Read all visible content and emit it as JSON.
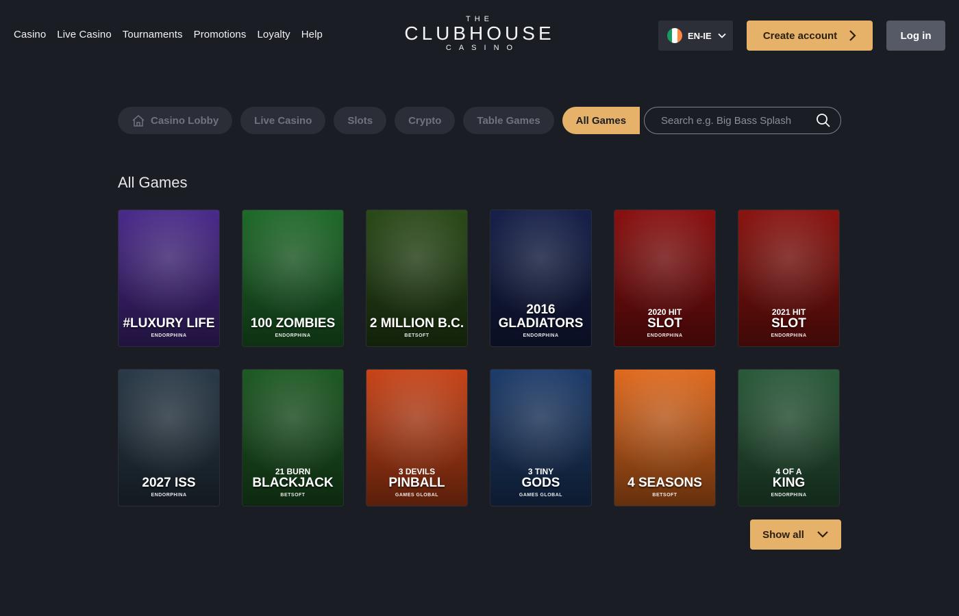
{
  "nav": {
    "links": [
      "Casino",
      "Live Casino",
      "Tournaments",
      "Promotions",
      "Loyalty",
      "Help"
    ]
  },
  "logo": {
    "top": "THE",
    "name": "CLUBHOUSE",
    "bottom": "CASINO"
  },
  "language": {
    "label": "EN-IE",
    "flag": "ireland-flag-icon"
  },
  "header": {
    "create_label": "Create account",
    "login_label": "Log in"
  },
  "filters": {
    "items": [
      "Casino Lobby",
      "Live Casino",
      "Slots",
      "Crypto",
      "Table Games",
      "All Games"
    ],
    "active": "All Games"
  },
  "search": {
    "placeholder": "Search e.g. Big Bass Splash"
  },
  "section_title": "All Games",
  "games": [
    {
      "pre": "",
      "title": "#LUXURY LIFE",
      "provider": "ENDORPHINA",
      "color": "#4a2a8a"
    },
    {
      "pre": "",
      "title": "100 ZOMBIES",
      "provider": "ENDORPHINA",
      "color": "#1f6a2a"
    },
    {
      "pre": "",
      "title": "2 MILLION B.C.",
      "provider": "BETSOFT",
      "color": "#2a4a18"
    },
    {
      "pre": "",
      "title": "2016 GLADIATORS",
      "provider": "ENDORPHINA",
      "color": "#16204a"
    },
    {
      "pre": "2020 HIT",
      "title": "SLOT",
      "provider": "ENDORPHINA",
      "color": "#8a1010"
    },
    {
      "pre": "2021 HIT",
      "title": "SLOT",
      "provider": "ENDORPHINA",
      "color": "#8a1410"
    },
    {
      "pre": "",
      "title": "2027 ISS",
      "provider": "ENDORPHINA",
      "color": "#2a3a48"
    },
    {
      "pre": "21 BURN",
      "title": "BLACKJACK",
      "provider": "BETSOFT",
      "color": "#1e5a24"
    },
    {
      "pre": "3 DEVILS",
      "title": "PINBALL",
      "provider": "GAMES GLOBAL",
      "color": "#c84418"
    },
    {
      "pre": "3 TINY",
      "title": "GODS",
      "provider": "GAMES GLOBAL",
      "color": "#1e3c6a"
    },
    {
      "pre": "",
      "title": "4 SEASONS",
      "provider": "BETSOFT",
      "color": "#e06a1e"
    },
    {
      "pre": "4 OF A",
      "title": "KING",
      "provider": "ENDORPHINA",
      "color": "#2a5a3a"
    }
  ],
  "show_all_label": "Show all",
  "colors": {
    "background": "#1b1d24",
    "accent": "#e6b26a",
    "pill": "#2b2e36"
  }
}
